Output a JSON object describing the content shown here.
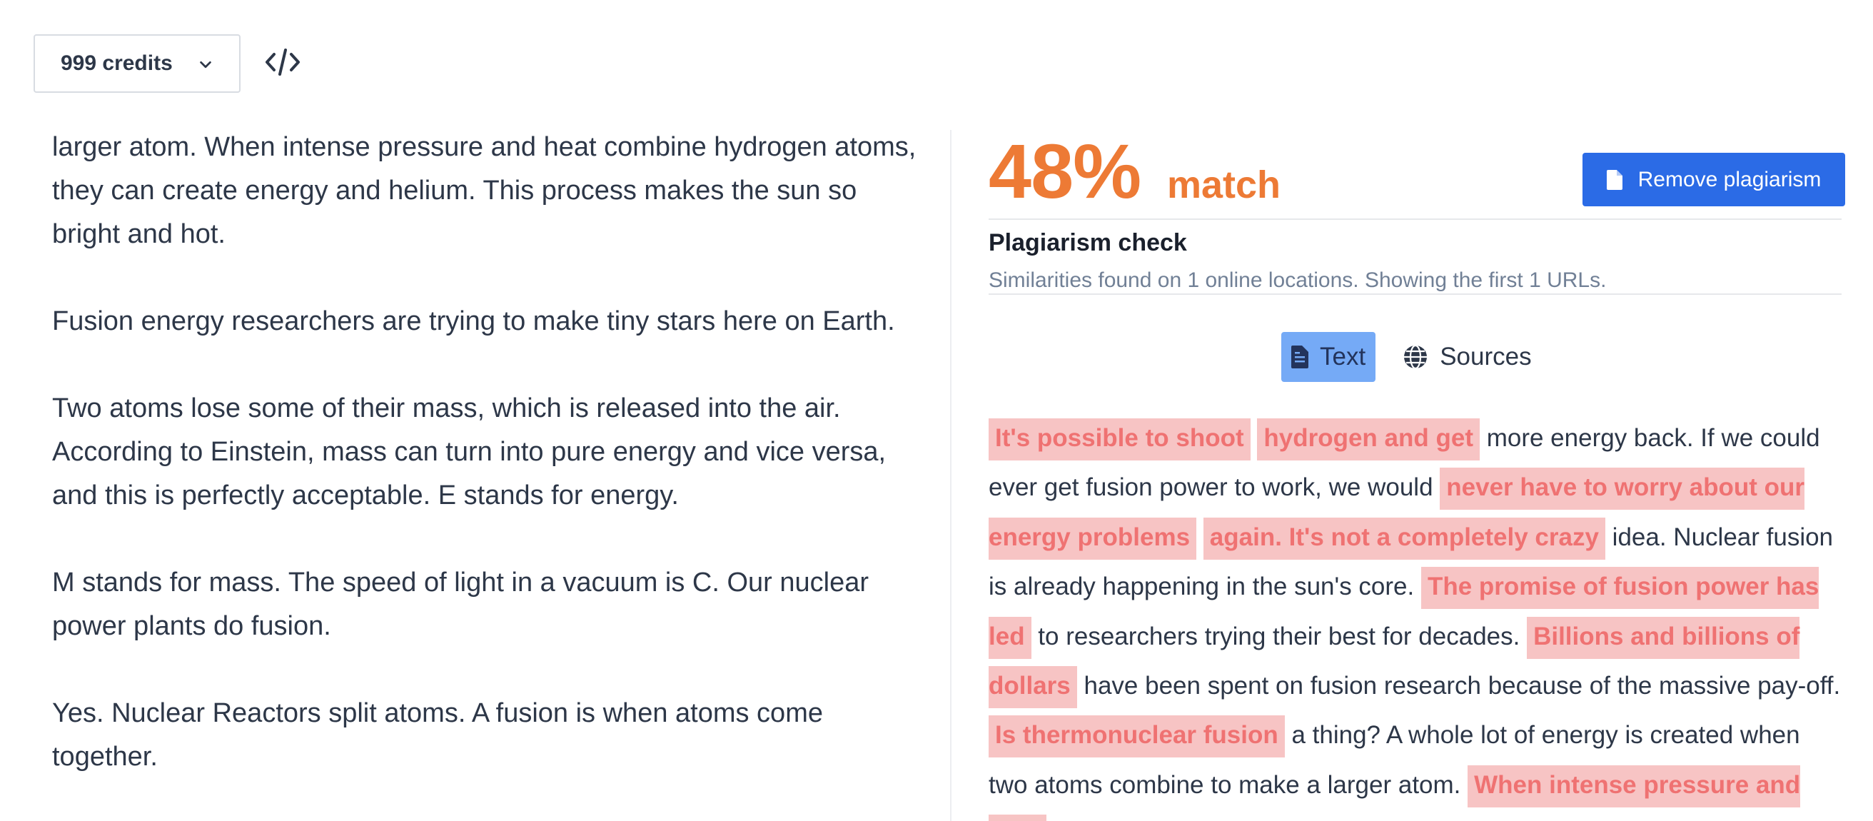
{
  "header": {
    "credits_label": "999 credits",
    "code_icon": "code-icon"
  },
  "left": {
    "paragraphs": [
      "larger atom. When intense pressure and heat combine hydrogen atoms, they can create energy and helium. This process makes the sun so bright and hot.",
      "Fusion energy researchers are trying to make tiny stars here on Earth.",
      "Two atoms lose some of their mass, which is released into the air. According to Einstein, mass can turn into pure energy and vice versa, and this is perfectly acceptable. E stands for energy.",
      "M stands for mass. The speed of light in a vacuum is C. Our nuclear power plants do fusion.",
      "Yes. Nuclear Reactors split atoms. A fusion is when atoms come together."
    ]
  },
  "result": {
    "percent": "48%",
    "match_word": "match",
    "remove_button": "Remove plagiarism",
    "check_title": "Plagiarism check",
    "check_subtitle": "Similarities found on 1 online locations. Showing the first 1 URLs.",
    "tabs": [
      {
        "label": "Text",
        "icon": "document-icon",
        "active": true
      },
      {
        "label": "Sources",
        "icon": "globe-icon",
        "active": false
      }
    ],
    "segments": [
      {
        "text": "It's possible to shoot",
        "hl": true
      },
      {
        "text": " ",
        "hl": false
      },
      {
        "text": "hydrogen and get",
        "hl": true
      },
      {
        "text": " more energy back. If we could ever get fusion power to work, we would ",
        "hl": false
      },
      {
        "text": "never have to worry about our energy problems",
        "hl": true
      },
      {
        "text": " ",
        "hl": false
      },
      {
        "text": "again. It's not a completely crazy",
        "hl": true
      },
      {
        "text": " idea. Nuclear fusion is already happening in the sun's core. ",
        "hl": false
      },
      {
        "text": "The promise of fusion power has led",
        "hl": true
      },
      {
        "text": " to researchers trying their best for decades. ",
        "hl": false
      },
      {
        "text": "Billions and billions of dollars",
        "hl": true
      },
      {
        "text": " have been spent on fusion research because of the massive pay-off. ",
        "hl": false
      },
      {
        "text": "Is thermonuclear fusion",
        "hl": true
      },
      {
        "text": " a thing? A whole lot of energy is created when two atoms combine to make a larger atom. ",
        "hl": false
      },
      {
        "text": "When intense pressure and heat",
        "hl": true
      }
    ]
  },
  "colors": {
    "accent_orange": "#ed7a35",
    "primary_blue": "#2b6be6",
    "highlight_bg": "#f7c4c4",
    "highlight_text": "#ef7272"
  }
}
